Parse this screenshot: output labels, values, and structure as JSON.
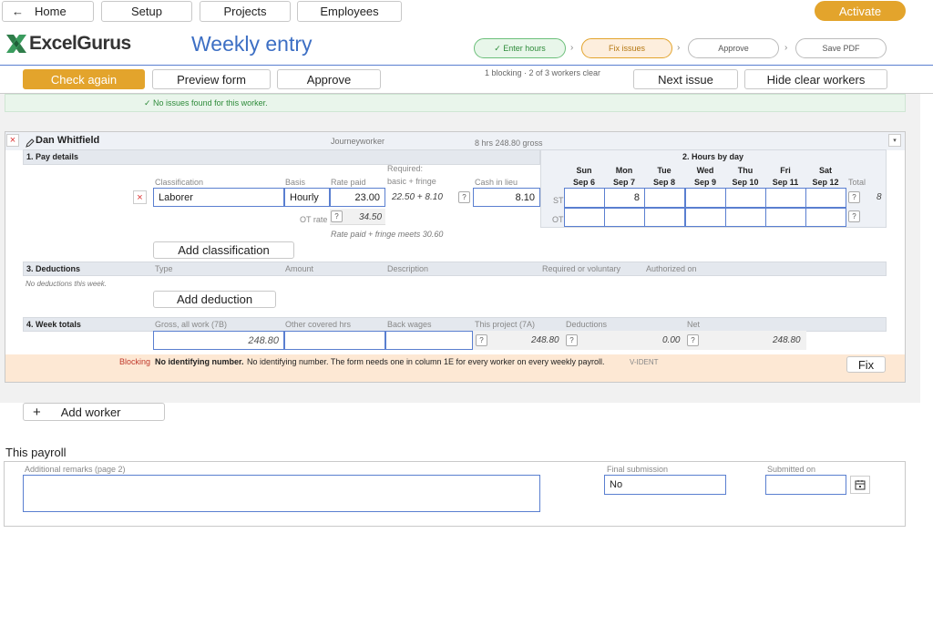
{
  "nav": {
    "home": "Home",
    "setup": "Setup",
    "projects": "Projects",
    "employees": "Employees",
    "activate": "Activate"
  },
  "brand": {
    "logo": "ExcelGurus",
    "page_title": "Weekly entry"
  },
  "steps": [
    "✓ Enter hours",
    "Fix issues",
    "Approve",
    "Save PDF"
  ],
  "toolbar": {
    "check_again": "Check again",
    "preview_form": "Preview form",
    "approve": "Approve",
    "status": "1 blocking · 2 of 3 workers clear",
    "next_issue": "Next issue",
    "hide_clear": "Hide clear workers"
  },
  "prev_worker": {
    "message": "✓ No issues found for this worker."
  },
  "worker": {
    "name": "Dan Whitfield",
    "class_label": "Journeyworker",
    "summary": "8 hrs   248.80 gross",
    "pay": {
      "section": "1. Pay details",
      "headers": {
        "classification": "Classification",
        "basis": "Basis",
        "rate_paid": "Rate paid",
        "required": "Required:",
        "required_sub": "basic + fringe",
        "cash": "Cash in lieu"
      },
      "classification": "Laborer",
      "basis": "Hourly",
      "rate_paid": "23.00",
      "required_value": "22.50 + 8.10",
      "cash": "8.10",
      "ot_rate_label": "OT rate",
      "ot_rate": "34.50",
      "note": "Rate paid + fringe meets 30.60",
      "add_classification": "Add classification"
    },
    "hours": {
      "section": "2. Hours by day",
      "days": [
        {
          "d": "Sun",
          "date": "Sep 6"
        },
        {
          "d": "Mon",
          "date": "Sep 7"
        },
        {
          "d": "Tue",
          "date": "Sep 8"
        },
        {
          "d": "Wed",
          "date": "Sep 9"
        },
        {
          "d": "Thu",
          "date": "Sep 10"
        },
        {
          "d": "Fri",
          "date": "Sep 11"
        },
        {
          "d": "Sat",
          "date": "Sep 12"
        }
      ],
      "total_label": "Total",
      "st_label": "ST",
      "ot_label": "OT",
      "st": [
        "",
        "8",
        "",
        "",
        "",
        "",
        ""
      ],
      "ot": [
        "",
        "",
        "",
        "",
        "",
        "",
        ""
      ],
      "st_total": "8",
      "ot_total": ""
    },
    "deductions": {
      "section": "3. Deductions",
      "headers": {
        "type": "Type",
        "amount": "Amount",
        "description": "Description",
        "required": "Required or voluntary",
        "authorized": "Authorized on"
      },
      "empty": "No deductions this week.",
      "add": "Add deduction"
    },
    "totals": {
      "section": "4. Week totals",
      "headers": {
        "gross": "Gross, all work (7B)",
        "other": "Other covered hrs",
        "back": "Back wages",
        "project": "This project (7A)",
        "deductions": "Deductions",
        "net": "Net"
      },
      "gross": "248.80",
      "project": "248.80",
      "deductions": "0.00",
      "net": "248.80"
    },
    "issue": {
      "level": "Blocking",
      "title": "No identifying number.",
      "text": "No identifying number. The form needs one in column 1E for every worker on every weekly payroll.",
      "code": "V-IDENT",
      "fix": "Fix"
    }
  },
  "add_worker": "Add worker",
  "payroll": {
    "title": "This payroll",
    "remarks_label": "Additional remarks (page 2)",
    "final_label": "Final submission",
    "final_value": "No",
    "submitted_label": "Submitted on"
  },
  "colors": {
    "accent": "#e3a42c",
    "link_blue": "#3d6fc4",
    "ok_green": "#2e8b3a",
    "blocking_red": "#c0392b"
  }
}
